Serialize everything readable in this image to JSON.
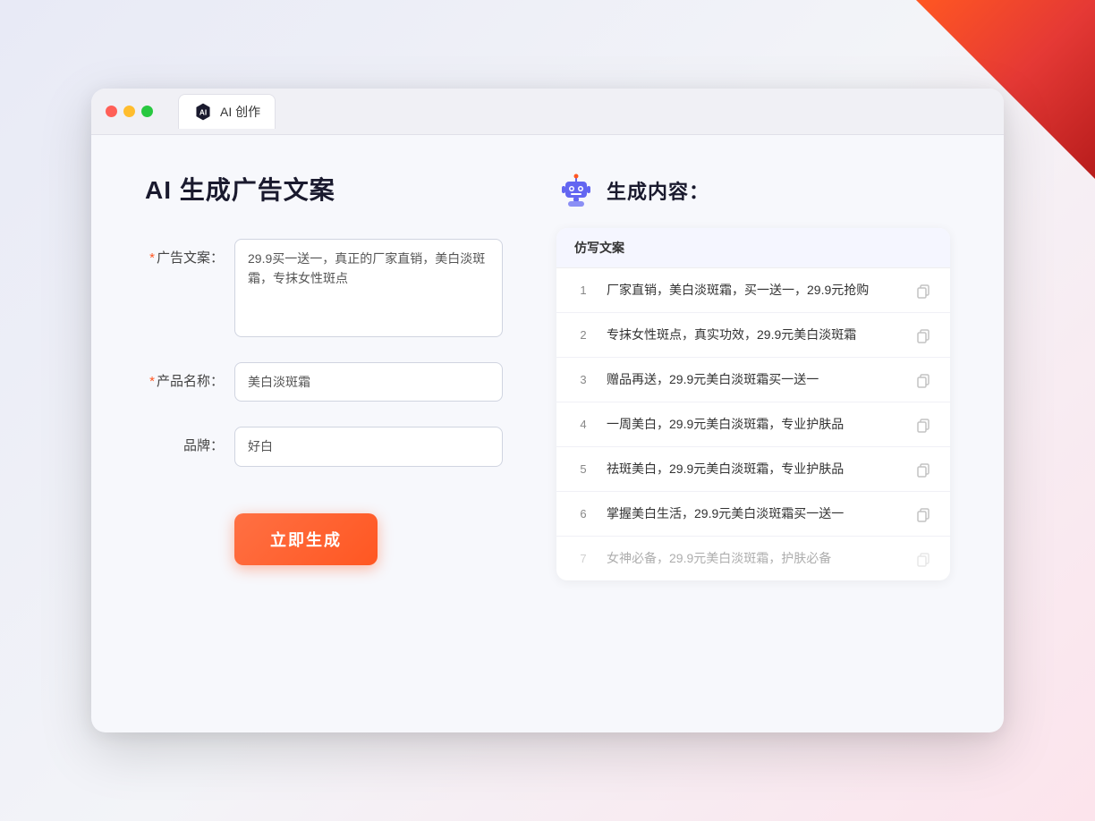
{
  "page": {
    "background_color": "#f0f2f8"
  },
  "tab": {
    "title": "AI 创作"
  },
  "left": {
    "page_title": "AI 生成广告文案",
    "form": {
      "ad_copy_label": "广告文案：",
      "ad_copy_required": "*",
      "ad_copy_value": "29.9买一送一，真正的厂家直销，美白淡斑霜，专抹女性斑点",
      "product_name_label": "产品名称：",
      "product_name_required": "*",
      "product_name_value": "美白淡斑霜",
      "brand_label": "品牌：",
      "brand_value": "好白"
    },
    "generate_button": "立即生成"
  },
  "right": {
    "title": "生成内容：",
    "table_header": "仿写文案",
    "results": [
      {
        "num": "1",
        "text": "厂家直销，美白淡斑霜，买一送一，29.9元抢购"
      },
      {
        "num": "2",
        "text": "专抹女性斑点，真实功效，29.9元美白淡斑霜"
      },
      {
        "num": "3",
        "text": "赠品再送，29.9元美白淡斑霜买一送一"
      },
      {
        "num": "4",
        "text": "一周美白，29.9元美白淡斑霜，专业护肤品"
      },
      {
        "num": "5",
        "text": "祛斑美白，29.9元美白淡斑霜，专业护肤品"
      },
      {
        "num": "6",
        "text": "掌握美白生活，29.9元美白淡斑霜买一送一"
      },
      {
        "num": "7",
        "text": "女神必备，29.9元美白淡斑霜，护肤必备"
      }
    ]
  },
  "window_controls": {
    "close": "close",
    "minimize": "minimize",
    "maximize": "maximize"
  }
}
